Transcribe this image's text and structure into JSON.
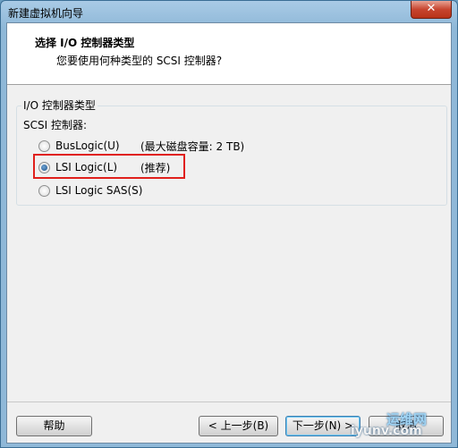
{
  "window": {
    "title": "新建虚拟机向导",
    "close_label": "✕"
  },
  "header": {
    "title": "选择 I/O 控制器类型",
    "subtitle": "您要使用何种类型的 SCSI 控制器?"
  },
  "group": {
    "legend": "I/O 控制器类型",
    "scsi_label": "SCSI 控制器:"
  },
  "options": [
    {
      "label": "BusLogic(U)",
      "note": "(最大磁盘容量: 2 TB)",
      "checked": false
    },
    {
      "label": "LSI Logic(L)",
      "note": "(推荐)",
      "checked": true
    },
    {
      "label": "LSI Logic SAS(S)",
      "note": "",
      "checked": false
    }
  ],
  "buttons": {
    "help": "帮助",
    "back": "< 上一步(B)",
    "next": "下一步(N) >",
    "cancel": "取消"
  },
  "watermark": {
    "top": "运维网",
    "bottom": "iyunv.com"
  }
}
